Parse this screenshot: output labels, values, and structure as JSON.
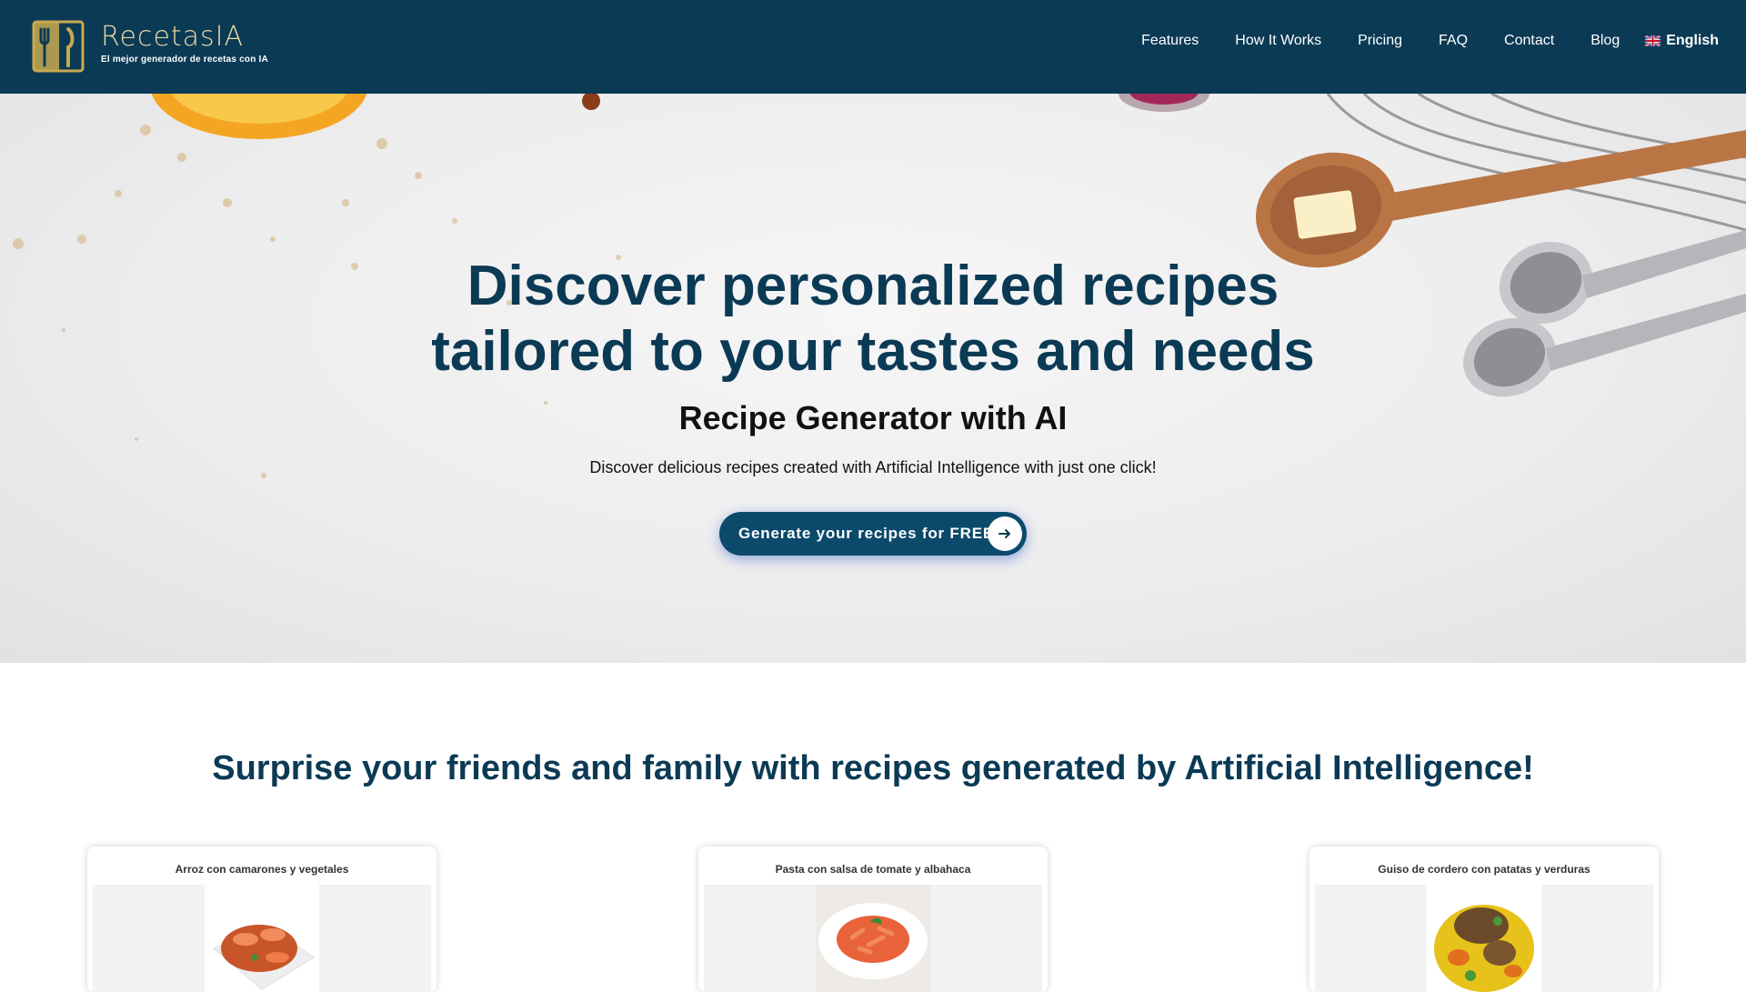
{
  "header": {
    "logo_name": "RecetasIA",
    "logo_tagline": "El mejor generador de recetas con IA",
    "nav": [
      "Features",
      "How It Works",
      "Pricing",
      "FAQ",
      "Contact",
      "Blog"
    ],
    "language": "English"
  },
  "hero": {
    "title_line1": "Discover personalized recipes",
    "title_line2": "tailored to your tastes and needs",
    "subtitle": "Recipe Generator with AI",
    "description": "Discover delicious recipes created with Artificial Intelligence with just one click!",
    "cta_label": "Generate your recipes for FREE"
  },
  "section": {
    "title": "Surprise your friends and family with recipes generated by Artificial Intelligence!"
  },
  "recipes": [
    {
      "title": "Arroz con camarones y vegetales"
    },
    {
      "title": "Pasta con salsa de tomate y albahaca"
    },
    {
      "title": "Guiso de cordero con patatas y verduras"
    }
  ],
  "colors": {
    "header_bg": "#0b3a55",
    "brand_gold": "#e8d8a6",
    "title_blue": "#0b3a55",
    "cta_bg": "#0b4a6b"
  }
}
